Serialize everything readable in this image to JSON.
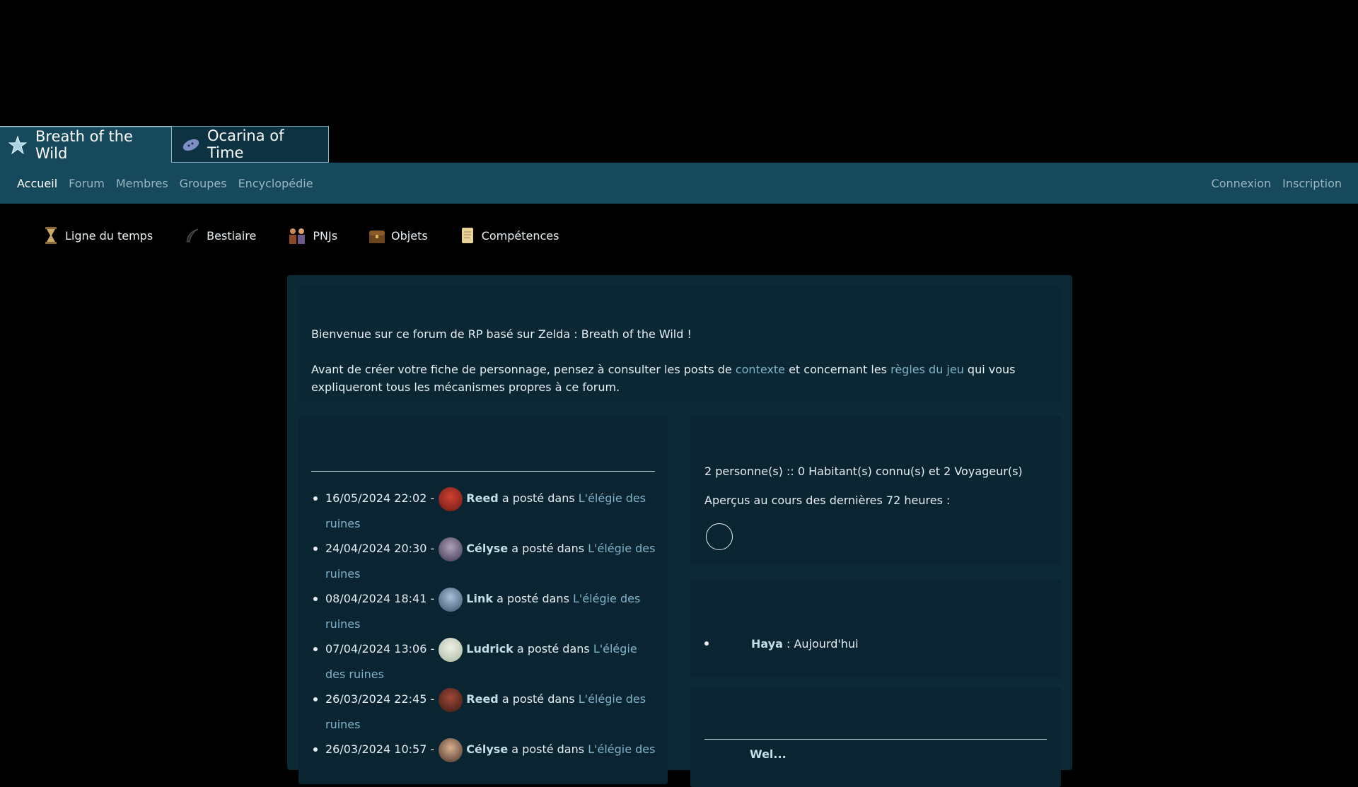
{
  "site_tabs": [
    {
      "label": "Breath of the Wild",
      "icon": "star-icon"
    },
    {
      "label": "Ocarina of Time",
      "icon": "ocarina-icon"
    }
  ],
  "nav": {
    "left": [
      "Accueil",
      "Forum",
      "Membres",
      "Groupes",
      "Encyclopédie"
    ],
    "right": [
      "Connexion",
      "Inscription"
    ],
    "active": "Accueil"
  },
  "quicklinks": [
    {
      "label": "Ligne du temps",
      "icon": "hourglass-icon"
    },
    {
      "label": "Bestiaire",
      "icon": "horn-icon"
    },
    {
      "label": "PNJs",
      "icon": "characters-icon"
    },
    {
      "label": "Objets",
      "icon": "chest-icon"
    },
    {
      "label": "Compétences",
      "icon": "scroll-icon"
    }
  ],
  "welcome": {
    "line1": "Bienvenue sur ce forum de RP basé sur Zelda : Breath of the Wild !",
    "line2_pre": "Avant de créer votre fiche de personnage, pensez à consulter les posts de ",
    "link1": "contexte",
    "line2_mid": " et concernant les ",
    "link2": "règles du jeu",
    "line2_post": " qui vous expliqueront tous les mécanismes propres à ce forum."
  },
  "posts": [
    {
      "date": "16/05/2024 22:02 -",
      "user": "Reed",
      "verb": "a posté dans",
      "topic": "L'élégie des ruines"
    },
    {
      "date": "24/04/2024 20:30 -",
      "user": "Célyse",
      "verb": "a posté dans",
      "topic": "L'élégie des ruines"
    },
    {
      "date": "08/04/2024 18:41 -",
      "user": "Link",
      "verb": "a posté dans",
      "topic": "L'élégie des ruines"
    },
    {
      "date": "07/04/2024 13:06 -",
      "user": "Ludrick",
      "verb": "a posté dans",
      "topic": "L'élégie des ruines"
    },
    {
      "date": "26/03/2024 22:45 -",
      "user": "Reed",
      "verb": "a posté dans",
      "topic": "L'élégie des ruines"
    },
    {
      "date": "26/03/2024 10:57 -",
      "user": "Célyse",
      "verb": "a posté dans",
      "topic": "L'élégie des"
    }
  ],
  "online": {
    "count_line": "2 personne(s) :: 0 Habitant(s) connu(s) et 2 Voyageur(s)",
    "recent_line": "Aperçus au cours des dernières 72 heures :"
  },
  "birthday": {
    "user": "Haya",
    "when": " : Aujourd'hui"
  },
  "bottom_cut": "Wel..."
}
